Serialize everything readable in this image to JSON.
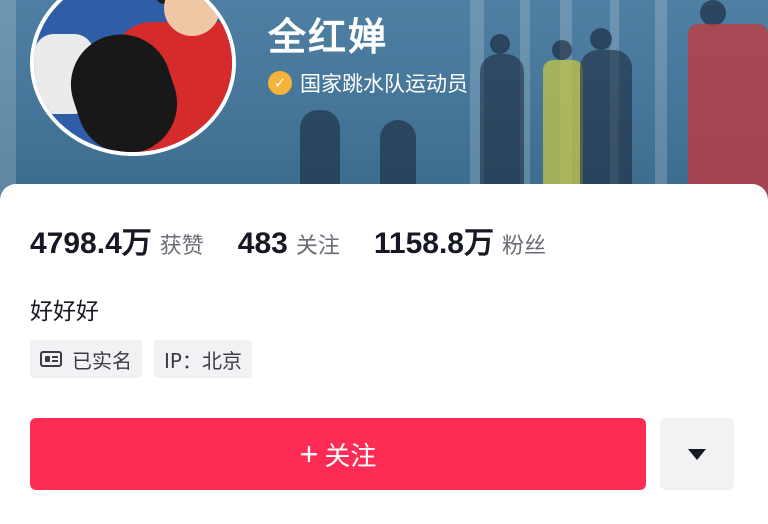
{
  "profile": {
    "name": "全红婵",
    "verified_text": "国家跳水队运动员",
    "bio": "好好好"
  },
  "stats": [
    {
      "value": "4798.4万",
      "label": "获赞"
    },
    {
      "value": "483",
      "label": "关注"
    },
    {
      "value": "1158.8万",
      "label": "粉丝"
    }
  ],
  "tags": {
    "real_name": "已实名",
    "ip": "IP：北京"
  },
  "actions": {
    "follow_plus": "+",
    "follow_label": "关注",
    "more_icon": "caret-down-icon"
  },
  "colors": {
    "accent": "#fe2c55",
    "verify": "#f4b43a",
    "banner": "#47779a"
  }
}
